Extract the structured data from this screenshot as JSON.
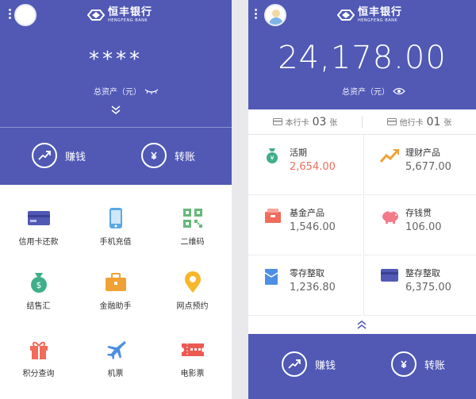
{
  "left": {
    "logo": {
      "cn": "恒丰银行",
      "en": "HENGFENG BANK"
    },
    "masked_balance": "****",
    "asset_label": "总资产（元）",
    "actions": {
      "earn": "赚钱",
      "transfer": "转账"
    },
    "grid": [
      {
        "label": "信用卡还款",
        "icon": "credit-card-icon"
      },
      {
        "label": "手机充值",
        "icon": "mobile-phone-icon"
      },
      {
        "label": "二维码",
        "icon": "qr-code-icon"
      },
      {
        "label": "结售汇",
        "icon": "forex-bag-icon"
      },
      {
        "label": "金融助手",
        "icon": "briefcase-icon"
      },
      {
        "label": "网点预约",
        "icon": "location-pin-icon"
      },
      {
        "label": "积分查询",
        "icon": "gift-icon"
      },
      {
        "label": "机票",
        "icon": "airplane-icon"
      },
      {
        "label": "电影票",
        "icon": "movie-ticket-icon"
      }
    ]
  },
  "right": {
    "logo": {
      "cn": "恒丰银行",
      "en": "HENGFENG BANK"
    },
    "total_assets": "24,178.00",
    "asset_label": "总资产（元）",
    "own_cards": {
      "label": "本行卡",
      "count": "03",
      "unit": "张"
    },
    "other_cards": {
      "label": "他行卡",
      "count": "01",
      "unit": "张"
    },
    "products": [
      {
        "name": "活期",
        "value": "2,654.00",
        "icon": "coin-bag-icon"
      },
      {
        "name": "理财产品",
        "value": "5,677.00",
        "icon": "trend-chart-icon"
      },
      {
        "name": "基金产品",
        "value": "1,546.00",
        "icon": "fund-box-icon"
      },
      {
        "name": "存钱贯",
        "value": "106.00",
        "icon": "piggy-bank-icon"
      },
      {
        "name": "零存整取",
        "value": "1,236.80",
        "icon": "envelope-icon"
      },
      {
        "name": "整存整取",
        "value": "6,375.00",
        "icon": "deposit-card-icon"
      }
    ],
    "actions": {
      "earn": "赚钱",
      "transfer": "转账"
    }
  },
  "colors": {
    "brand_blue": "#5159b5",
    "highlight_red": "#f26b5b"
  }
}
